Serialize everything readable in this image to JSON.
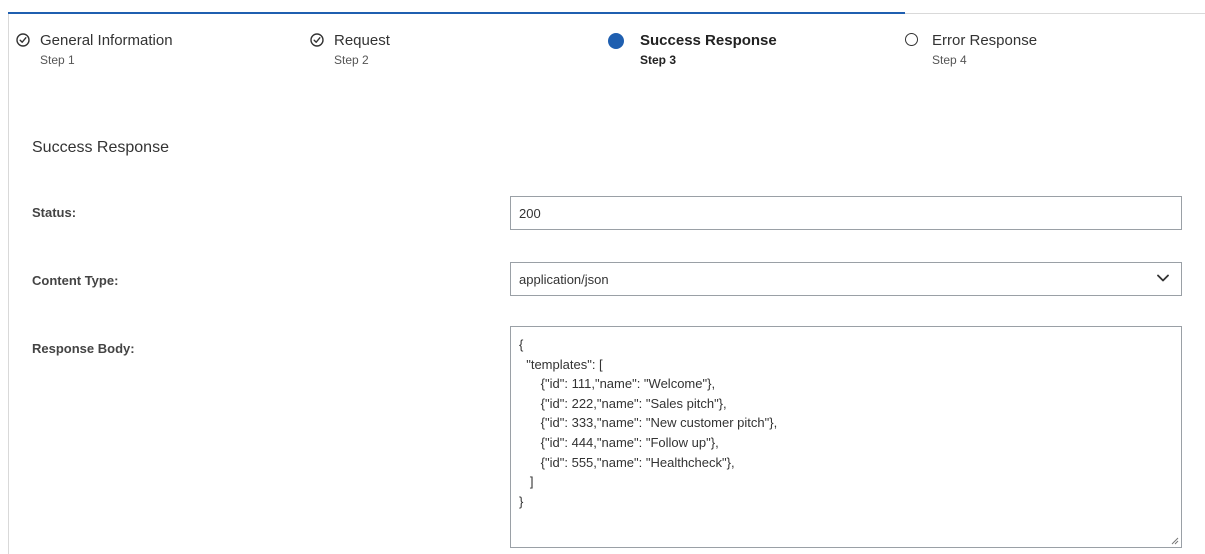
{
  "stepper": {
    "progress_percent": 75,
    "steps": [
      {
        "title": "General Information",
        "sub": "Step 1",
        "state": "completed"
      },
      {
        "title": "Request",
        "sub": "Step 2",
        "state": "completed"
      },
      {
        "title": "Success Response",
        "sub": "Step 3",
        "state": "active"
      },
      {
        "title": "Error Response",
        "sub": "Step 4",
        "state": "pending"
      }
    ]
  },
  "section": {
    "title": "Success Response"
  },
  "form": {
    "status_label": "Status:",
    "status_value": "200",
    "content_type_label": "Content Type:",
    "content_type_value": "application/json",
    "response_body_label": "Response Body:",
    "response_body_lines": [
      "{",
      "  \"templates\": [",
      "      {\"id\": 111,\"name\": \"Welcome\"},",
      "      {\"id\": 222,\"name\": \"Sales pitch\"},",
      "      {\"id\": 333,\"name\": \"New customer pitch\"},",
      "      {\"id\": 444,\"name\": \"Follow up\"},",
      "      {\"id\": 555,\"name\": \"Healthcheck\"},",
      "   ]",
      "}"
    ]
  },
  "colors": {
    "accent": "#1f5fb0",
    "border": "#9aa0a6",
    "divider": "#d9d9d9"
  },
  "icons": {
    "completed": "check-circle-icon",
    "active": "filled-circle-icon",
    "pending": "empty-circle-icon",
    "select": "chevron-down-icon",
    "resize": "resize-handle-icon"
  }
}
